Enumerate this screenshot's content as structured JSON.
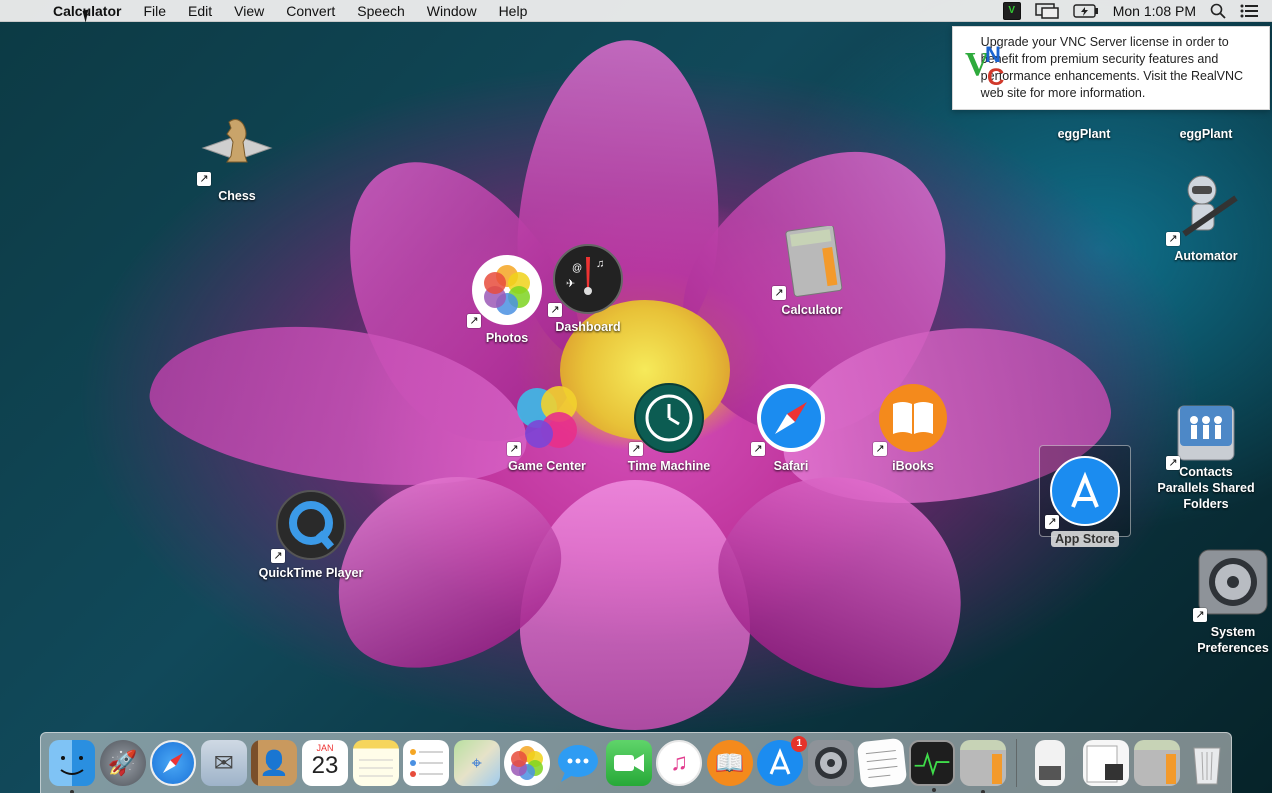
{
  "menubar": {
    "app_name": "Calculator",
    "menus": [
      "File",
      "Edit",
      "View",
      "Convert",
      "Speech",
      "Window",
      "Help"
    ],
    "clock": "Mon 1:08 PM",
    "status_icons": [
      "vnc-icon",
      "display-icon",
      "battery-icon",
      "spotlight-icon",
      "notification-center-icon"
    ]
  },
  "notice": {
    "text": "Upgrade your VNC Server license in order to benefit from premium security features and performance enhancements. Visit the RealVNC web site for more information."
  },
  "desktop_icons": {
    "chess": "Chess",
    "photos": "Photos",
    "dashboard": "Dashboard",
    "calculator": "Calculator",
    "game_center": "Game Center",
    "time_machine": "Time Machine",
    "safari": "Safari",
    "ibooks": "iBooks",
    "quicktime": "QuickTime Player",
    "app_store": "App Store",
    "eggplant1": "eggPlant",
    "eggplant2": "eggPlant",
    "automator": "Automator",
    "contacts": "Contacts",
    "parallels": "Parallels Shared Folders",
    "system_prefs": "System Preferences"
  },
  "dock": {
    "calendar_month": "JAN",
    "calendar_day": "23",
    "app_store_badge": "1"
  },
  "colors": {
    "accent_blue": "#1b8cf0",
    "badge_red": "#e5332a"
  }
}
